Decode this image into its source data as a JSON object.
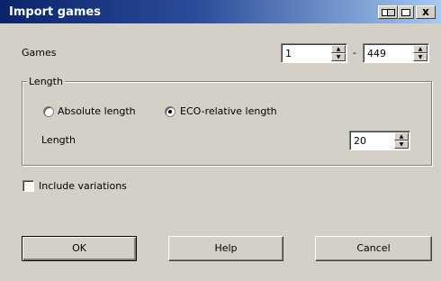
{
  "window": {
    "title": "Import games",
    "close_glyph": "x"
  },
  "games": {
    "label": "Games",
    "from_value": "1",
    "separator": "-",
    "to_value": "449"
  },
  "length_group": {
    "legend": "Length",
    "absolute_label": "Absolute length",
    "eco_label": "ECO-relative length",
    "selected": "eco",
    "length_label": "Length",
    "length_value": "20"
  },
  "include_variations": {
    "label": "Include variations",
    "checked": false
  },
  "buttons": {
    "ok": "OK",
    "help": "Help",
    "cancel": "Cancel"
  },
  "spinner_glyphs": {
    "up": "▲",
    "down": "▼"
  }
}
